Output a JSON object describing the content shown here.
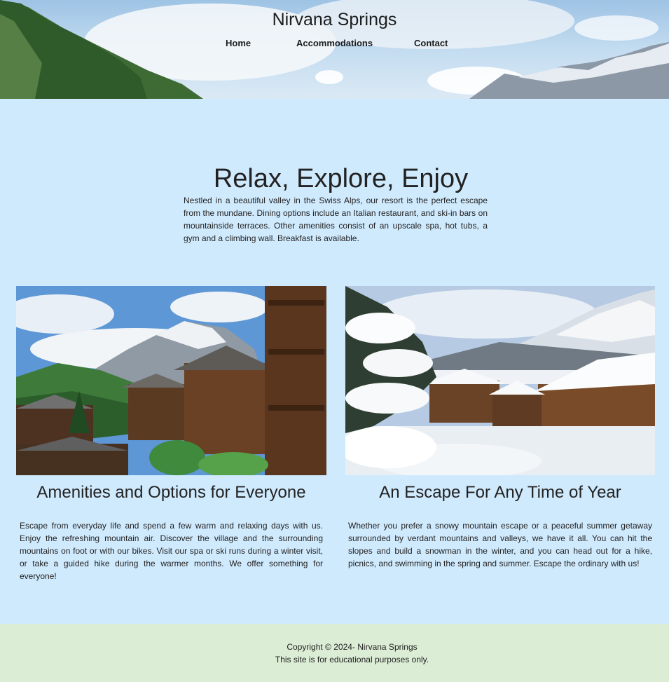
{
  "header": {
    "site_title": "Nirvana Springs",
    "nav": [
      "Home",
      "Accommodations",
      "Contact"
    ]
  },
  "intro": {
    "title": "Relax, Explore, Enjoy",
    "text": "Nestled in a beautiful valley in the Swiss Alps, our resort is the perfect escape from the mundane. Dining options include an Italian restaurant, and ski-in bars on mountainside terraces. Other amenities consist of an upscale spa, hot tubs, a gym and a climbing wall. Breakfast is available."
  },
  "features": [
    {
      "title": "Amenities and Options for Everyone",
      "text": "Escape from everyday life and spend a few warm and relaxing days with us. Enjoy the refreshing mountain air. Discover the village and the surrounding mountains on foot or with our bikes. Visit our spa or ski runs during a winter visit, or take a guided hike during the warmer months. We offer something for everyone!"
    },
    {
      "title": "An Escape For Any Time of Year",
      "text": "Whether you prefer a snowy mountain escape or a peaceful summer getaway surrounded by verdant mountains and valleys, we have it all. You can hit the slopes and build a snowman in the winter, and you can head out for a hike, picnics, and swimming in the spring and summer. Escape the ordinary with us!"
    }
  ],
  "footer": {
    "copyright": "Copyright © 2024- Nirvana Springs",
    "note": "This site is for educational purposes only."
  }
}
